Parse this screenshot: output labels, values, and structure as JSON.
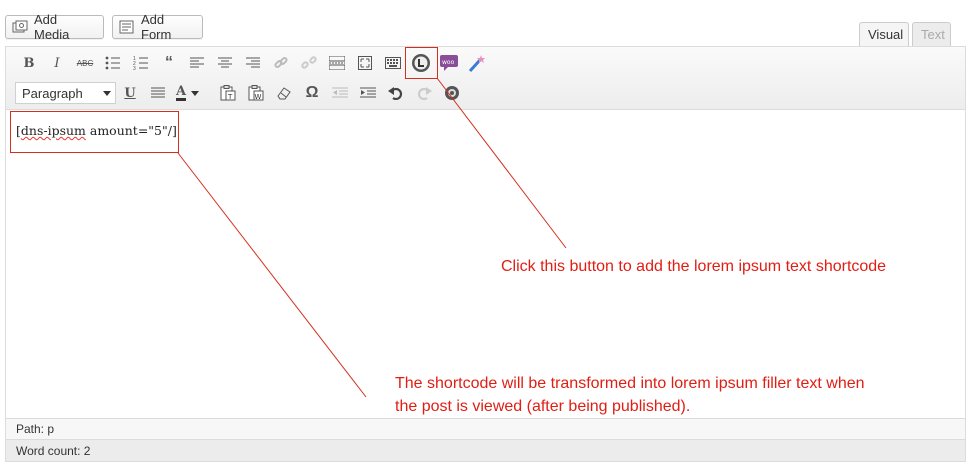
{
  "media_buttons": {
    "add_media": "Add Media",
    "add_form": "Add Form"
  },
  "editor_tabs": {
    "visual": "Visual",
    "text": "Text"
  },
  "toolbar": {
    "row1_icons": [
      "bold-icon",
      "italic-icon",
      "strikethrough-icon",
      "bulleted-list-icon",
      "numbered-list-icon",
      "blockquote-icon",
      "align-left-icon",
      "align-center-icon",
      "align-right-icon",
      "insert-link-icon",
      "unlink-icon",
      "read-more-icon",
      "fullscreen-icon",
      "toolbar-toggle-icon",
      "lorem-ipsum-icon",
      "woocommerce-icon",
      "magic-wand-icon"
    ],
    "row2_icons": [
      "underline-icon",
      "justify-icon",
      "text-color-icon",
      "paste-text-icon",
      "paste-word-icon",
      "clear-formatting-icon",
      "special-character-icon",
      "outdent-icon",
      "indent-icon",
      "undo-icon",
      "redo-icon",
      "help-icon"
    ],
    "format_select": "Paragraph",
    "bold_glyph": "B",
    "italic_glyph": "I",
    "strike_glyph": "ABC",
    "underline_glyph": "U",
    "color_glyph": "A",
    "omega_glyph": "Ω"
  },
  "content": {
    "shortcode_prefix": "[",
    "shortcode_spell": "dns-ipsum",
    "shortcode_rest": " amount=\"5\"/]"
  },
  "status": {
    "path": "Path: p",
    "word_count": "Word count: 2"
  },
  "annotations": {
    "button_note": "Click this button to add the lorem ipsum text shortcode",
    "shortcode_note_line1": "The shortcode will be transformed into lorem ipsum filler text when",
    "shortcode_note_line2": "the post is viewed (after being published).",
    "color": "#e01e14"
  }
}
